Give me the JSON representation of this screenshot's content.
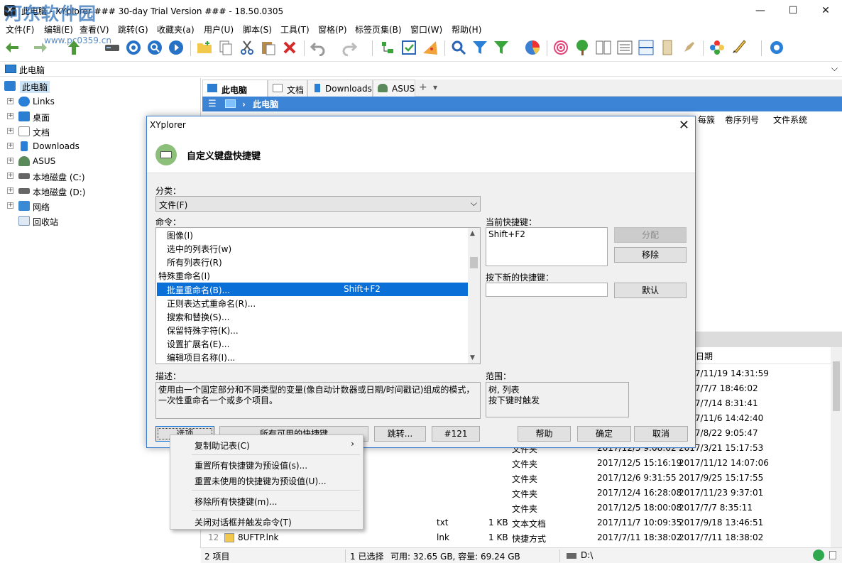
{
  "window": {
    "title": "此电脑 - XYplorer ### 30-day Trial Version ### - 18.50.0305",
    "watermark": "河东软件园",
    "watermark_url": "www.pc0359.cn",
    "controls": {
      "minimize": "—",
      "maximize": "☐",
      "close": "✕"
    }
  },
  "menu": [
    "文件(F)",
    "编辑(E)",
    "查看(V)",
    "跳转(G)",
    "收藏夹(a)",
    "用户(U)",
    "脚本(S)",
    "工具(T)",
    "窗格(P)",
    "标签页集(B)",
    "窗口(W)",
    "帮助(H)"
  ],
  "address": {
    "value": "此电脑"
  },
  "tree": {
    "root": "此电脑",
    "items": [
      "Links",
      "桌面",
      "文档",
      "Downloads",
      "ASUS",
      "本地磁盘 (C:)",
      "本地磁盘 (D:)",
      "网络",
      "回收站"
    ]
  },
  "tabs": [
    "此电脑",
    "文档",
    "Downloads",
    "ASUS"
  ],
  "tab_controls": {
    "add": "+",
    "menu": "▾"
  },
  "breadcrumb": {
    "current": "此电脑",
    "sep": "›"
  },
  "columns_top": [
    "每簇",
    "卷序列号",
    "文件系统"
  ],
  "file_list": {
    "date_header": "日期",
    "rows": [
      {
        "num": "",
        "name": "",
        "ext": "",
        "size": "",
        "type": "",
        "modified": "",
        "date": "2017/11/19 14:31:59"
      },
      {
        "num": "",
        "name": "",
        "ext": "",
        "size": "",
        "type": "",
        "modified": "",
        "date": "2017/7/7 18:46:02"
      },
      {
        "num": "",
        "name": "",
        "ext": "",
        "size": "",
        "type": "",
        "modified": "",
        "date": "2017/7/14 8:31:41"
      },
      {
        "num": "",
        "name": "",
        "ext": "",
        "size": "",
        "type": "",
        "modified": "",
        "date": "2017/11/6 14:42:40"
      },
      {
        "num": "",
        "name": "",
        "ext": "",
        "size": "",
        "type": "",
        "modified": "",
        "date": "2017/8/22 9:05:47"
      },
      {
        "num": "",
        "name": "",
        "ext": "",
        "size": "",
        "type": "文件夹",
        "modified": "2017/12/5 9:08:02",
        "date": "2017/3/21 15:17:53"
      },
      {
        "num": "",
        "name": "",
        "ext": "",
        "size": "",
        "type": "文件夹",
        "modified": "2017/12/5 15:16:19",
        "date": "2017/11/12 14:07:06"
      },
      {
        "num": "",
        "name": "",
        "ext": "",
        "size": "",
        "type": "文件夹",
        "modified": "2017/12/6 9:31:55",
        "date": "2017/9/25 15:17:55"
      },
      {
        "num": "",
        "name": "",
        "ext": "",
        "size": "",
        "type": "文件夹",
        "modified": "2017/12/4 16:28:08",
        "date": "2017/11/23 9:37:01"
      },
      {
        "num": "",
        "name": "",
        "ext": "",
        "size": "",
        "type": "文件夹",
        "modified": "2017/12/5 18:00:08",
        "date": "2017/7/7 8:35:11"
      },
      {
        "num": "",
        "name": "",
        "ext": "txt",
        "size": "1 KB",
        "type": "文本文档",
        "modified": "2017/11/7 10:09:35",
        "date": "2017/9/18 13:46:51"
      },
      {
        "num": "12",
        "name": "8UFTP.lnk",
        "ext": "lnk",
        "size": "1 KB",
        "type": "快捷方式",
        "modified": "2017/7/11 18:38:02",
        "date": "2017/7/11 18:38:02"
      }
    ]
  },
  "status": {
    "items": "2 项目",
    "selection": "1 已选择",
    "free": "可用: 32.65 GB, 容量: 69.24 GB",
    "drive": "D:\\"
  },
  "dialog": {
    "title": "XYplorer",
    "heading": "自定义键盘快捷键",
    "category_label": "分类：",
    "category_value": "文件(F)",
    "commands_label": "命令：",
    "commands": [
      {
        "label": "图像(I)",
        "shortcut": "",
        "indent": true,
        "selected": false
      },
      {
        "label": "选中的列表行(w)",
        "shortcut": "",
        "indent": true,
        "selected": false
      },
      {
        "label": "所有列表行(R)",
        "shortcut": "",
        "indent": true,
        "selected": false
      },
      {
        "label": "特殊重命名(I)",
        "shortcut": "",
        "indent": false,
        "selected": false
      },
      {
        "label": "批量重命名(B)...",
        "shortcut": "Shift+F2",
        "indent": true,
        "selected": true
      },
      {
        "label": "正则表达式重命名(R)...",
        "shortcut": "",
        "indent": true,
        "selected": false
      },
      {
        "label": "搜索和替换(S)...",
        "shortcut": "",
        "indent": true,
        "selected": false
      },
      {
        "label": "保留特殊字符(K)...",
        "shortcut": "",
        "indent": true,
        "selected": false
      },
      {
        "label": "设置扩展名(E)...",
        "shortcut": "",
        "indent": true,
        "selected": false
      },
      {
        "label": "编辑项目名称(I)...",
        "shortcut": "",
        "indent": true,
        "selected": false
      }
    ],
    "current_shortcut_label": "当前快捷键：",
    "current_shortcut": "Shift+F2",
    "new_shortcut_label": "按下新的快捷键：",
    "new_shortcut_value": "",
    "assign_button": "分配",
    "remove_button": "移除",
    "default_button": "默认",
    "description_label": "描述：",
    "description": "使用由一个固定部分和不同类型的变量(像自动计数器或日期/时间戳记)组成的模式，一次性重命名一个或多个项目。",
    "scope_label": "范围：",
    "scope_line1": "树, 列表",
    "scope_line2": "按下键时触发",
    "buttons": {
      "options": "选项",
      "all_shortcuts": "所有可用的快捷键",
      "goto": "跳转...",
      "id": "#121",
      "help": "帮助",
      "ok": "确定",
      "cancel": "取消"
    }
  },
  "context_menu": {
    "items": [
      "复制助记表(C)",
      "重置所有快捷键为预设值(s)...",
      "重置未使用的快捷键为预设值(U)...",
      "移除所有快捷键(m)...",
      "关闭对话框并触发命令(T)"
    ],
    "submenu_arrow": "›"
  },
  "ui_glyphs": {
    "expand": "+",
    "combo_caret": "⌵",
    "scroll_up": "▲",
    "scroll_down": "▼",
    "hamburger": "☰"
  }
}
